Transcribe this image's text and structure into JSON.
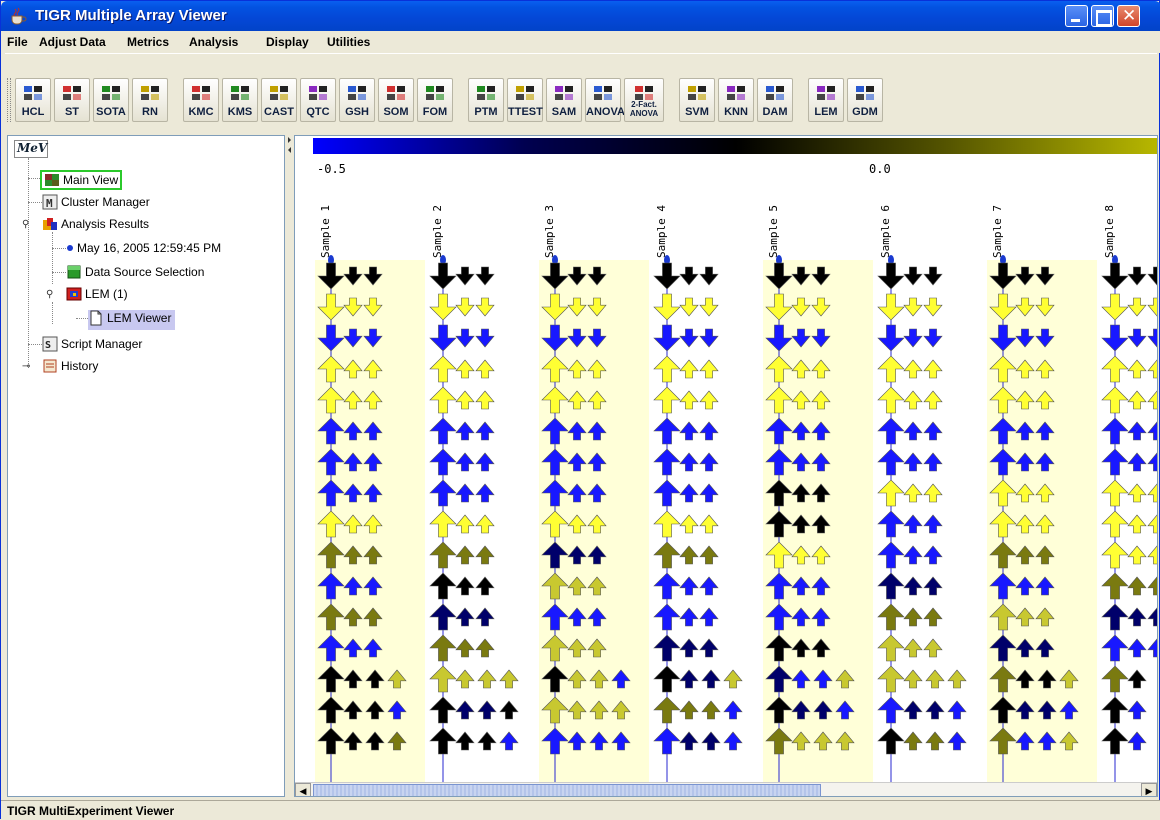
{
  "window": {
    "title": "TIGR Multiple Array Viewer"
  },
  "menu": [
    "File",
    "Adjust Data",
    "Metrics",
    "Analysis",
    "Display",
    "Utilities"
  ],
  "toolbar": {
    "groups": [
      [
        "HCL",
        "ST",
        "SOTA",
        "RN"
      ],
      [
        "KMC",
        "KMS",
        "CAST",
        "QTC",
        "GSH",
        "SOM",
        "FOM"
      ],
      [
        "PTM",
        "TTEST",
        "SAM",
        "ANOVA",
        "2-Fact. ANOVA"
      ],
      [
        "SVM",
        "KNN",
        "DAM"
      ],
      [
        "LEM",
        "GDM"
      ]
    ]
  },
  "tree": {
    "logo": "MeV",
    "items": [
      {
        "label": "Main View",
        "icon": "main-view-icon"
      },
      {
        "label": "Cluster Manager",
        "icon": "cluster-manager-icon"
      },
      {
        "label": "Analysis Results",
        "icon": "analysis-results-icon"
      },
      {
        "label": "May 16, 2005 12:59:45 PM",
        "icon": "bullet-icon"
      },
      {
        "label": "Data Source Selection",
        "icon": "data-source-icon"
      },
      {
        "label": "LEM (1)",
        "icon": "lem-icon"
      },
      {
        "label": "LEM Viewer",
        "icon": "document-icon"
      },
      {
        "label": "Script Manager",
        "icon": "script-manager-icon"
      },
      {
        "label": "History",
        "icon": "history-icon"
      }
    ]
  },
  "viewer": {
    "scale_min": "-0.5",
    "scale_mid": "0.0",
    "samples": [
      "Sample 1",
      "Sample 2",
      "Sample 3",
      "Sample 4",
      "Sample 5",
      "Sample 6",
      "Sample 7",
      "Sample 8"
    ],
    "colors": {
      "Y": "#ffff33",
      "B": "#1818ff",
      "K": "#000000",
      "O": "#7a7a10",
      "N": "#00006a",
      "L": "#c8c830"
    },
    "rows": [
      [
        "K3",
        "K3",
        "K3",
        "K3",
        "K3",
        "K3",
        "K3",
        "K3"
      ],
      [
        "Y3",
        "Y3",
        "Y3",
        "Y3",
        "Y3",
        "Y3",
        "Y3",
        "Y3"
      ],
      [
        "B3",
        "B3",
        "B3",
        "B3",
        "B3",
        "B3",
        "B3",
        "B3"
      ],
      [
        "Y3",
        "Y3",
        "Y3",
        "Y3",
        "Y3",
        "Y3",
        "Y3",
        "Y3"
      ],
      [
        "Y3",
        "Y3",
        "Y3",
        "Y3",
        "Y3",
        "Y3",
        "Y3",
        "Y3"
      ],
      [
        "B3",
        "B3",
        "B3",
        "B3",
        "B3",
        "B3",
        "B3",
        "B3"
      ],
      [
        "B3",
        "B3",
        "B3",
        "B3",
        "B3",
        "B3",
        "B3",
        "B3"
      ],
      [
        "B3",
        "B3",
        "B3",
        "B3",
        "K3",
        "Y3",
        "Y3",
        "Y3"
      ],
      [
        "Y3",
        "Y3",
        "Y3",
        "Y3",
        "K3",
        "B3",
        "Y3",
        "Y3"
      ],
      [
        "O3",
        "O3",
        "N3",
        "O3",
        "Y3",
        "B3",
        "O3",
        "Y3"
      ],
      [
        "B3",
        "K3",
        "L3",
        "B3",
        "B3",
        "N3",
        "B3",
        "O3"
      ],
      [
        "O3",
        "N3",
        "B3",
        "B3",
        "B3",
        "O3",
        "L3",
        "N3"
      ],
      [
        "B3",
        "O3",
        "L3",
        "N3",
        "K3",
        "L3",
        "N3",
        "B3"
      ],
      [
        "KKKL",
        "LLLL",
        "KLLB",
        "KNNL",
        "NBBL",
        "LLLL",
        "OKKL",
        "OK"
      ],
      [
        "KKKB",
        "KNNK",
        "LLLL",
        "OOOB",
        "KNNB",
        "BNNB",
        "KNNB",
        "KB"
      ],
      [
        "KKKO",
        "KKKB",
        "BBBB",
        "BNNB",
        "OLLL",
        "KOOB",
        "OBBL",
        "KB"
      ]
    ]
  }
}
